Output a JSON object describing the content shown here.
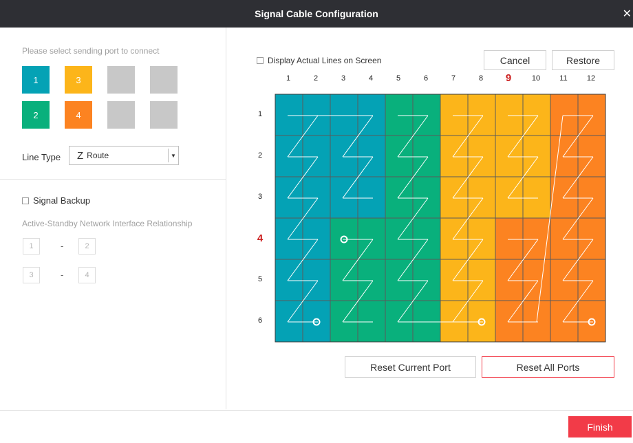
{
  "dialog": {
    "title": "Signal Cable Configuration"
  },
  "left": {
    "hint": "Please select sending port to connect",
    "ports": [
      {
        "label": "1",
        "color": "#04a2b5"
      },
      {
        "label": "3",
        "color": "#fcb51a"
      },
      {
        "label": "",
        "color": "#c8c8c8"
      },
      {
        "label": "",
        "color": "#c8c8c8"
      },
      {
        "label": "2",
        "color": "#09b07c"
      },
      {
        "label": "4",
        "color": "#fc8321"
      },
      {
        "label": "",
        "color": "#c8c8c8"
      },
      {
        "label": "",
        "color": "#c8c8c8"
      }
    ],
    "line_type_label": "Line Type",
    "line_type_icon": "Z",
    "line_type_value": "Route",
    "signal_backup_label": "Signal Backup",
    "active_standby_label": "Active-Standby Network Interface Relationship",
    "pairs": [
      {
        "a": "1",
        "b": "2"
      },
      {
        "a": "3",
        "b": "4"
      }
    ],
    "dash": "-"
  },
  "right": {
    "display_actual_lines_label": "Display Actual Lines on Screen",
    "cancel_label": "Cancel",
    "restore_label": "Restore",
    "columns": [
      "1",
      "2",
      "3",
      "4",
      "5",
      "6",
      "7",
      "8",
      "9",
      "10",
      "11",
      "12"
    ],
    "rows": [
      "1",
      "2",
      "3",
      "4",
      "5",
      "6"
    ],
    "highlight_column": "9",
    "highlight_row": "4",
    "reset_current_label": "Reset Current Port",
    "reset_all_label": "Reset All Ports",
    "grid_colors": [
      [
        "#04a2b5",
        "#04a2b5",
        "#04a2b5",
        "#04a2b5",
        "#09b07c",
        "#09b07c",
        "#fcb51a",
        "#fcb51a",
        "#fcb51a",
        "#fcb51a",
        "#fc8321",
        "#fc8321"
      ],
      [
        "#04a2b5",
        "#04a2b5",
        "#04a2b5",
        "#04a2b5",
        "#09b07c",
        "#09b07c",
        "#fcb51a",
        "#fcb51a",
        "#fcb51a",
        "#fcb51a",
        "#fc8321",
        "#fc8321"
      ],
      [
        "#04a2b5",
        "#04a2b5",
        "#04a2b5",
        "#04a2b5",
        "#09b07c",
        "#09b07c",
        "#fcb51a",
        "#fcb51a",
        "#fcb51a",
        "#fcb51a",
        "#fc8321",
        "#fc8321"
      ],
      [
        "#04a2b5",
        "#04a2b5",
        "#09b07c",
        "#09b07c",
        "#09b07c",
        "#09b07c",
        "#fcb51a",
        "#fcb51a",
        "#fc8321",
        "#fc8321",
        "#fc8321",
        "#fc8321"
      ],
      [
        "#04a2b5",
        "#04a2b5",
        "#09b07c",
        "#09b07c",
        "#09b07c",
        "#09b07c",
        "#fcb51a",
        "#fcb51a",
        "#fc8321",
        "#fc8321",
        "#fc8321",
        "#fc8321"
      ],
      [
        "#04a2b5",
        "#04a2b5",
        "#09b07c",
        "#09b07c",
        "#09b07c",
        "#09b07c",
        "#fcb51a",
        "#fcb51a",
        "#fc8321",
        "#fc8321",
        "#fc8321",
        "#fc8321"
      ]
    ]
  },
  "footer": {
    "finish_label": "Finish",
    "finish_color": "#f23b48"
  }
}
